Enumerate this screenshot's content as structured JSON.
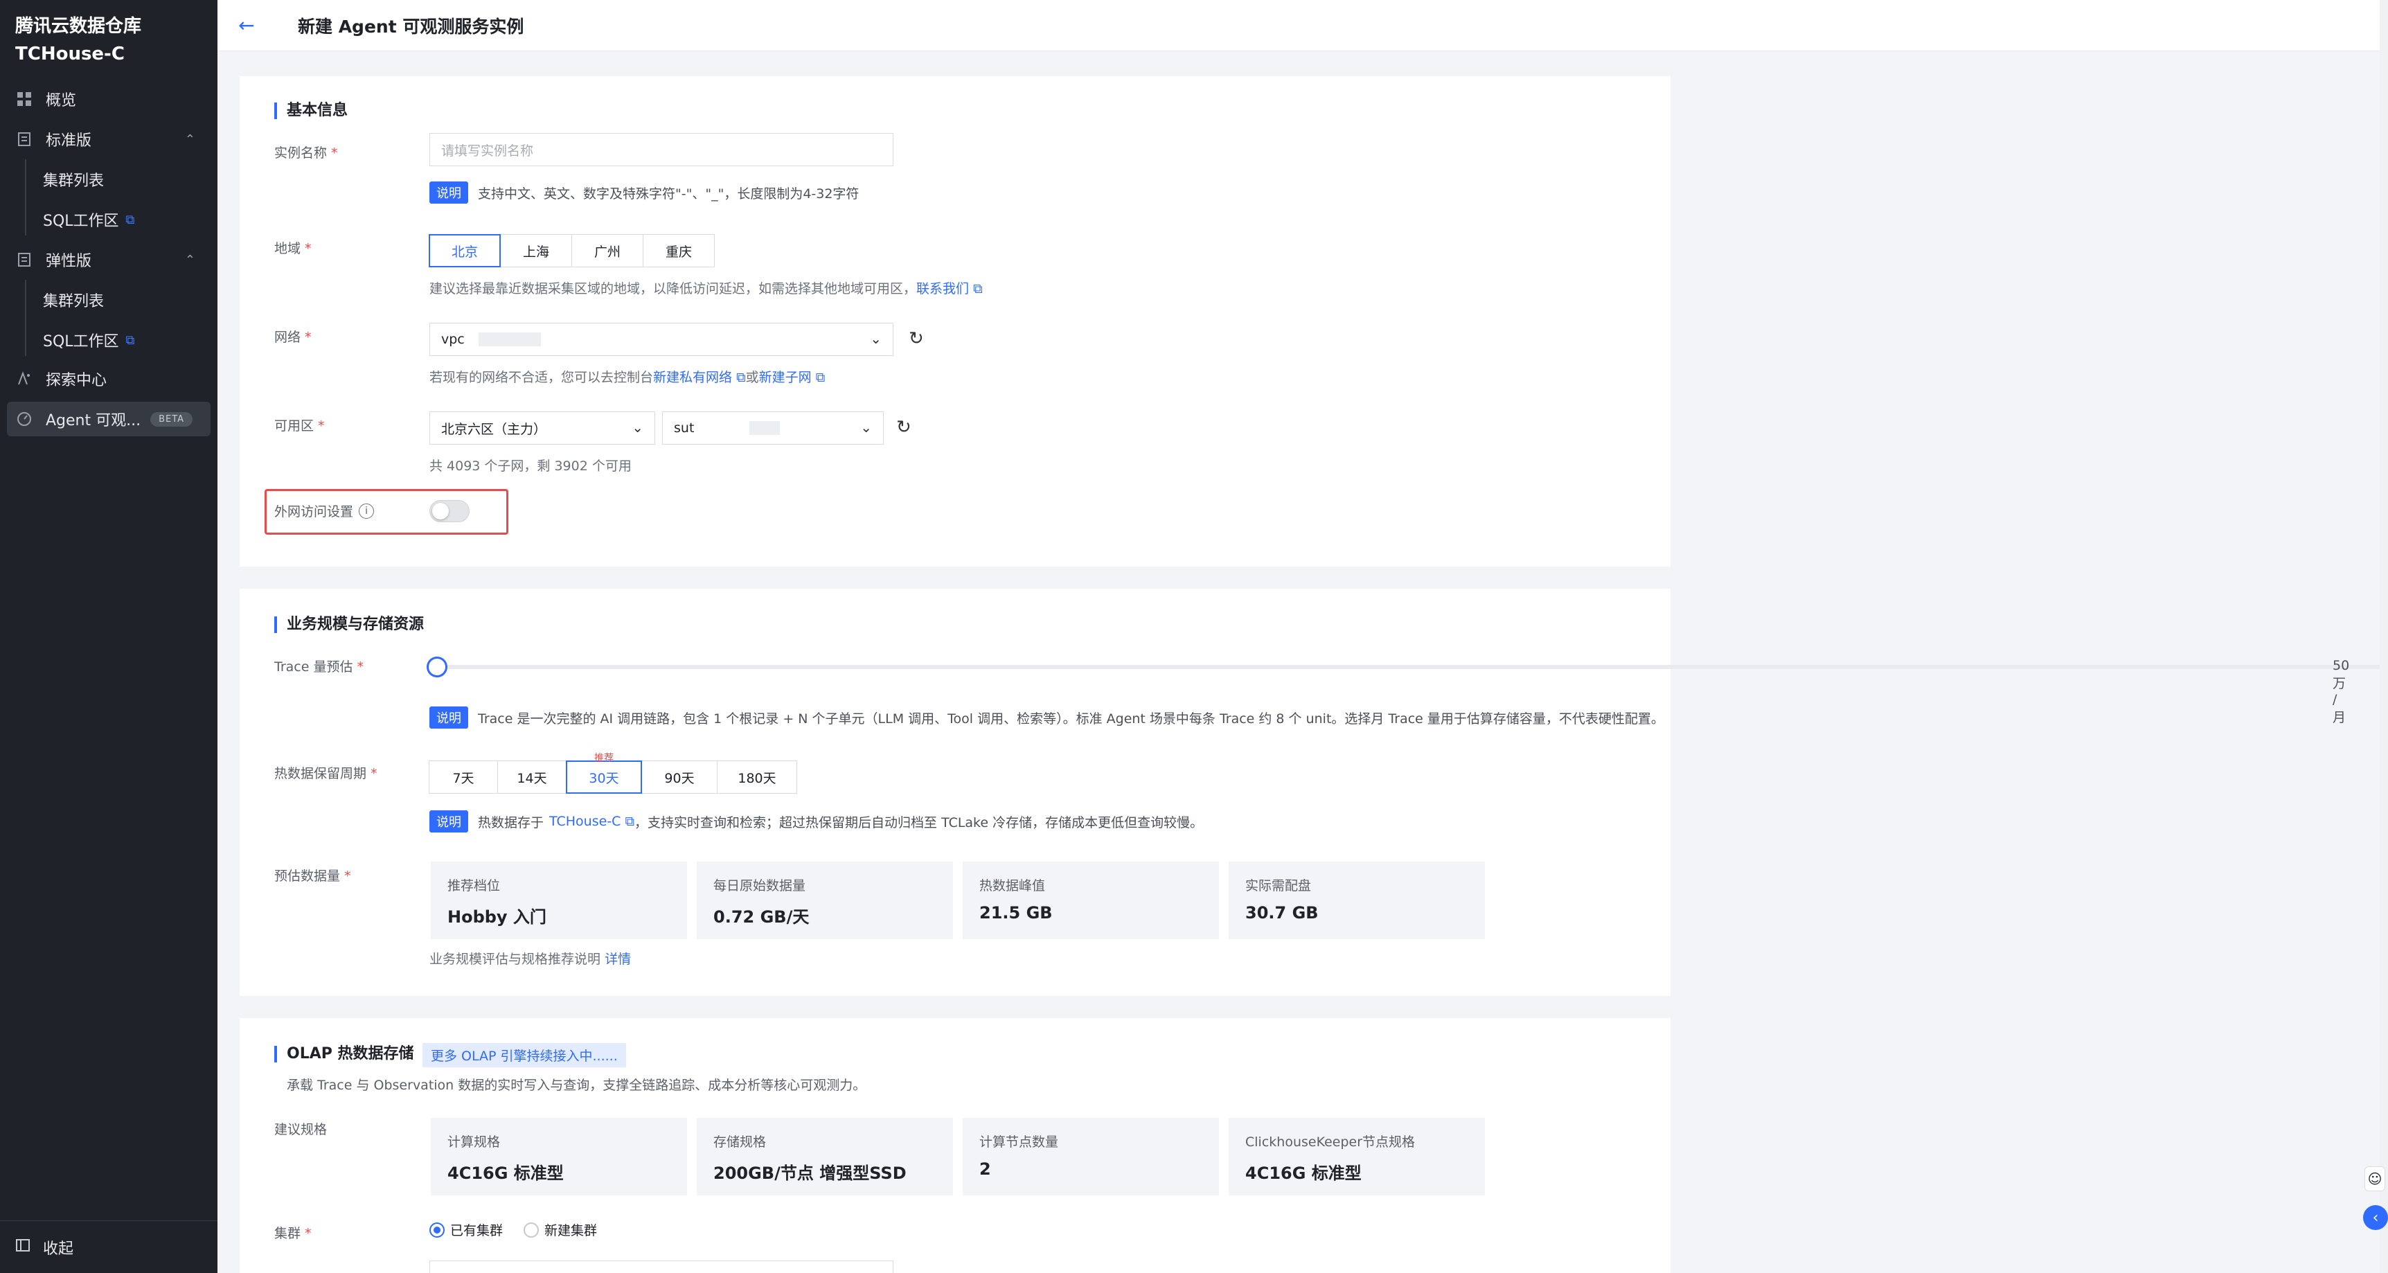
{
  "sidebar": {
    "brand_line1": "腾讯云数据仓库",
    "brand_line2": "TCHouse-C",
    "overview": "概览",
    "standard": "标准版",
    "standard_cluster_list": "集群列表",
    "standard_sql_workspace": "SQL工作区",
    "elastic": "弹性版",
    "elastic_cluster_list": "集群列表",
    "elastic_sql_workspace": "SQL工作区",
    "explore": "探索中心",
    "agent": "Agent 可观...",
    "agent_badge": "BETA",
    "collapse": "收起"
  },
  "header": {
    "title": "新建 Agent 可观测服务实例"
  },
  "basic": {
    "title": "基本信息",
    "name_label": "实例名称",
    "name_placeholder": "请填写实例名称",
    "name_tip_badge": "说明",
    "name_tip": "支持中文、英文、数字及特殊字符\"-\"、\"_\"，长度限制为4-32字符",
    "region_label": "地域",
    "regions": [
      "北京",
      "上海",
      "广州",
      "重庆"
    ],
    "region_hint": "建议选择最靠近数据采集区域的地域，以降低访问延迟，如需选择其他地域可用区，",
    "region_link": "联系我们",
    "network_label": "网络",
    "network_value": "vpc",
    "network_hint": "若现有的网络不合适，您可以去控制台",
    "network_link1": "新建私有网络",
    "network_or": "或",
    "network_link2": "新建子网",
    "zone_label": "可用区",
    "zone_value": "北京六区（主力）",
    "subnet_value": "sut",
    "subnet_hint": "共 4093 个子网，剩 3902 个可用",
    "public_label": "外网访问设置"
  },
  "scale": {
    "title": "业务规模与存储资源",
    "trace_label": "Trace 量预估",
    "trace_value": "50 万 / 月",
    "trace_level": 0.0,
    "trace_tip_badge": "说明",
    "trace_tip": "Trace 是一次完整的 AI 调用链路，包含 1 个根记录 + N 个子单元（LLM 调用、Tool 调用、检索等）。标准 Agent 场景中每条 Trace 约 8 个 unit。选择月 Trace 量用于估算存储容量，不代表硬性配置。",
    "retention_label": "热数据保留周期",
    "retention_options": [
      "7天",
      "14天",
      "30天",
      "90天",
      "180天"
    ],
    "recommend": "推荐",
    "retention_tip_badge": "说明",
    "retention_tip_pre": "热数据存于",
    "retention_tip_link": "TCHouse-C",
    "retention_tip_post": "，支持实时查询和检索；超过热保留期后自动归档至 TCLake 冷存储，存储成本更低但查询较慢。",
    "estimate_label": "预估数据量",
    "stats": [
      {
        "k": "推荐档位",
        "v": "Hobby 入门"
      },
      {
        "k": "每日原始数据量",
        "v": "0.72 GB/天"
      },
      {
        "k": "热数据峰值",
        "v": "21.5 GB"
      },
      {
        "k": "实际需配盘",
        "v": "30.7 GB"
      }
    ],
    "footer_hint": "业务规模评估与规格推荐说明",
    "footer_link": "详情"
  },
  "olap": {
    "title": "OLAP 热数据存储",
    "tag": "更多 OLAP 引擎持续接入中......",
    "desc": "承载 Trace 与 Observation 数据的实时写入与查询，支撑全链路追踪、成本分析等核心可观测力。",
    "spec_label": "建议规格",
    "specs": [
      {
        "k": "计算规格",
        "v": "4C16G 标准型"
      },
      {
        "k": "存储规格",
        "v": "200GB/节点 增强型SSD"
      },
      {
        "k": "计算节点数量",
        "v": "2"
      },
      {
        "k": "ClickhouseKeeper节点规格",
        "v": "4C16G 标准型"
      }
    ],
    "cluster_label": "集群",
    "cluster_existing": "已有集群",
    "cluster_new": "新建集群"
  }
}
